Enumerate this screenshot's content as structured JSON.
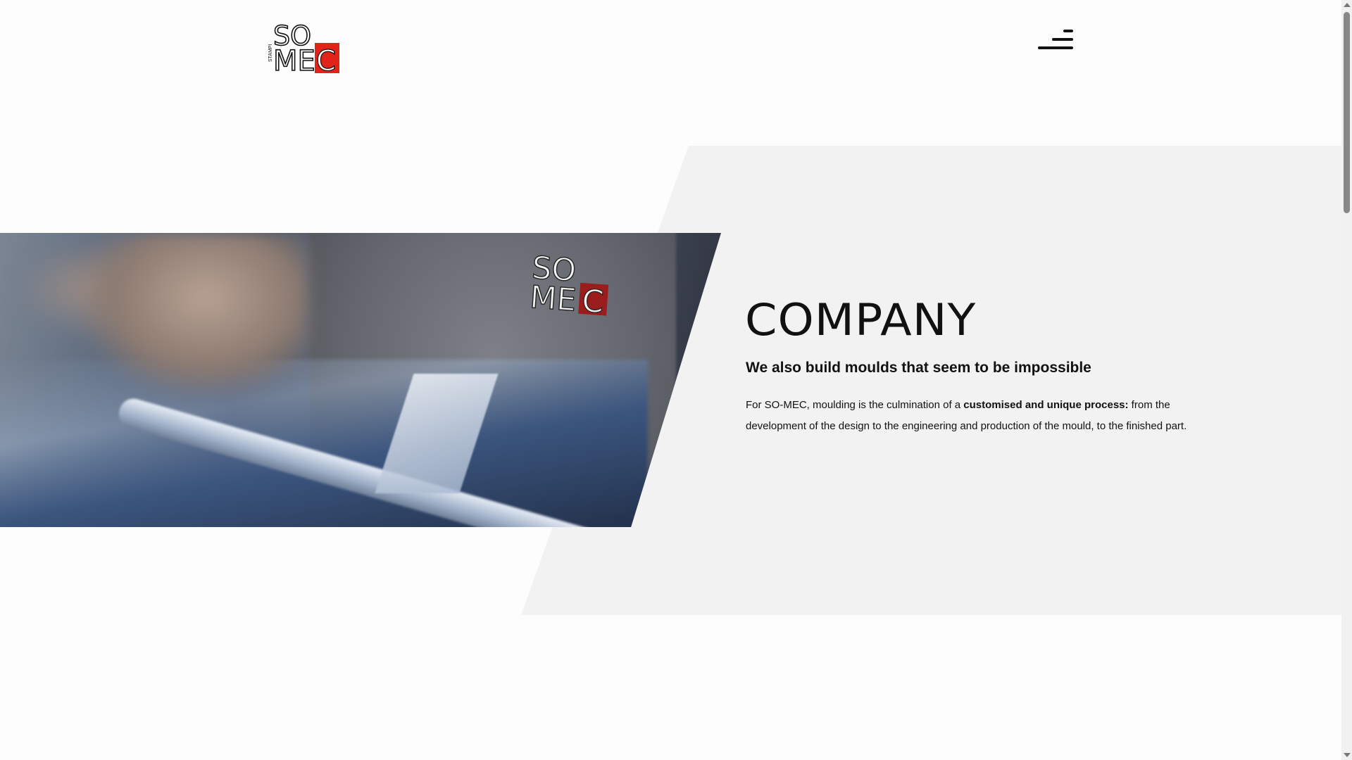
{
  "header": {
    "logo": {
      "text_top": "SO",
      "text_bottom_left": "ME",
      "text_bottom_right": "C",
      "side_text": "STAMPI",
      "accent": "#e2231a"
    },
    "menu_icon": "hamburger-menu-icon"
  },
  "hero": {
    "photo_badge": {
      "text_top": "SO",
      "text_bottom_left": "ME",
      "text_bottom_right": "C"
    }
  },
  "company": {
    "title": "COMPANY",
    "subtitle": "We also build moulds that seem to be impossible",
    "body_intro": "For SO-MEC, moulding is the culmination of a ",
    "body_bold": "customised and unique process:",
    "body_rest": " from the development of the design to the engineering and production of the mould, to the finished part."
  },
  "colors": {
    "panel_bg": "#f2f2f2",
    "text": "#111111",
    "brand_red": "#e2231a"
  }
}
